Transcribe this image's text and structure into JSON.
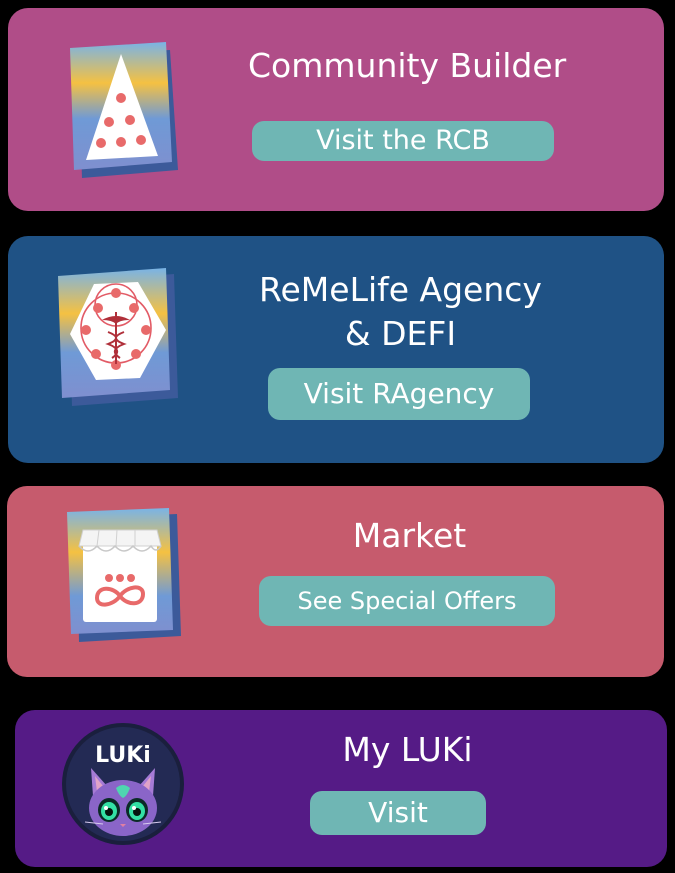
{
  "colors": {
    "community_card": "#b04d88",
    "agency_card": "#1f5285",
    "market_card": "#c65b6d",
    "luki_card": "#551b86",
    "button_bg": "#6fb6b4",
    "text": "#ffffff"
  },
  "cards": {
    "community": {
      "title": "Community Builder",
      "button_label": "Visit the RCB",
      "icon": "pyramid-dots-icon"
    },
    "agency": {
      "title_line1": "ReMeLife Agency",
      "title_line2": "& DEFI",
      "button_label": "Visit RAgency",
      "icon": "caduceus-hexagon-icon"
    },
    "market": {
      "title": "Market",
      "button_label": "See Special Offers",
      "icon": "storefront-icon"
    },
    "luki": {
      "title": "My LUKi",
      "button_label": "Visit",
      "icon": "luki-cat-avatar",
      "logo_text": "LUKi"
    }
  }
}
